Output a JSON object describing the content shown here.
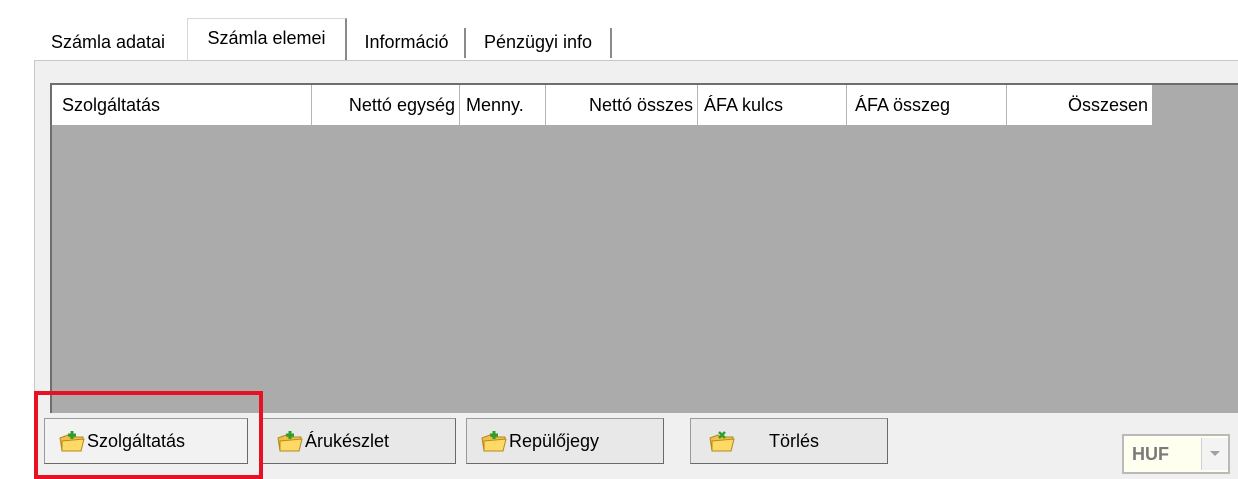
{
  "tabs": [
    {
      "label": "Számla adatai",
      "active": false
    },
    {
      "label": "Számla elemei",
      "active": true
    },
    {
      "label": "Információ",
      "active": false
    },
    {
      "label": "Pénzügyi info",
      "active": false
    }
  ],
  "grid": {
    "columns": [
      "Szolgáltatás",
      "Nettó egység",
      "Menny.",
      "Nettó összes",
      "ÁFA kulcs",
      "ÁFA összeg",
      "Összesen"
    ],
    "rows": []
  },
  "buttons": {
    "service": "Szolgáltatás",
    "stock": "Árukészlet",
    "ticket": "Repülőjegy",
    "delete": "Törlés"
  },
  "currency": {
    "selected": "HUF"
  },
  "icons": {
    "add_button_icon": "folder-add-icon",
    "dropdown_icon": "chevron-down-icon"
  },
  "colors": {
    "highlight": "#e81123",
    "grid_background": "#ababab"
  }
}
